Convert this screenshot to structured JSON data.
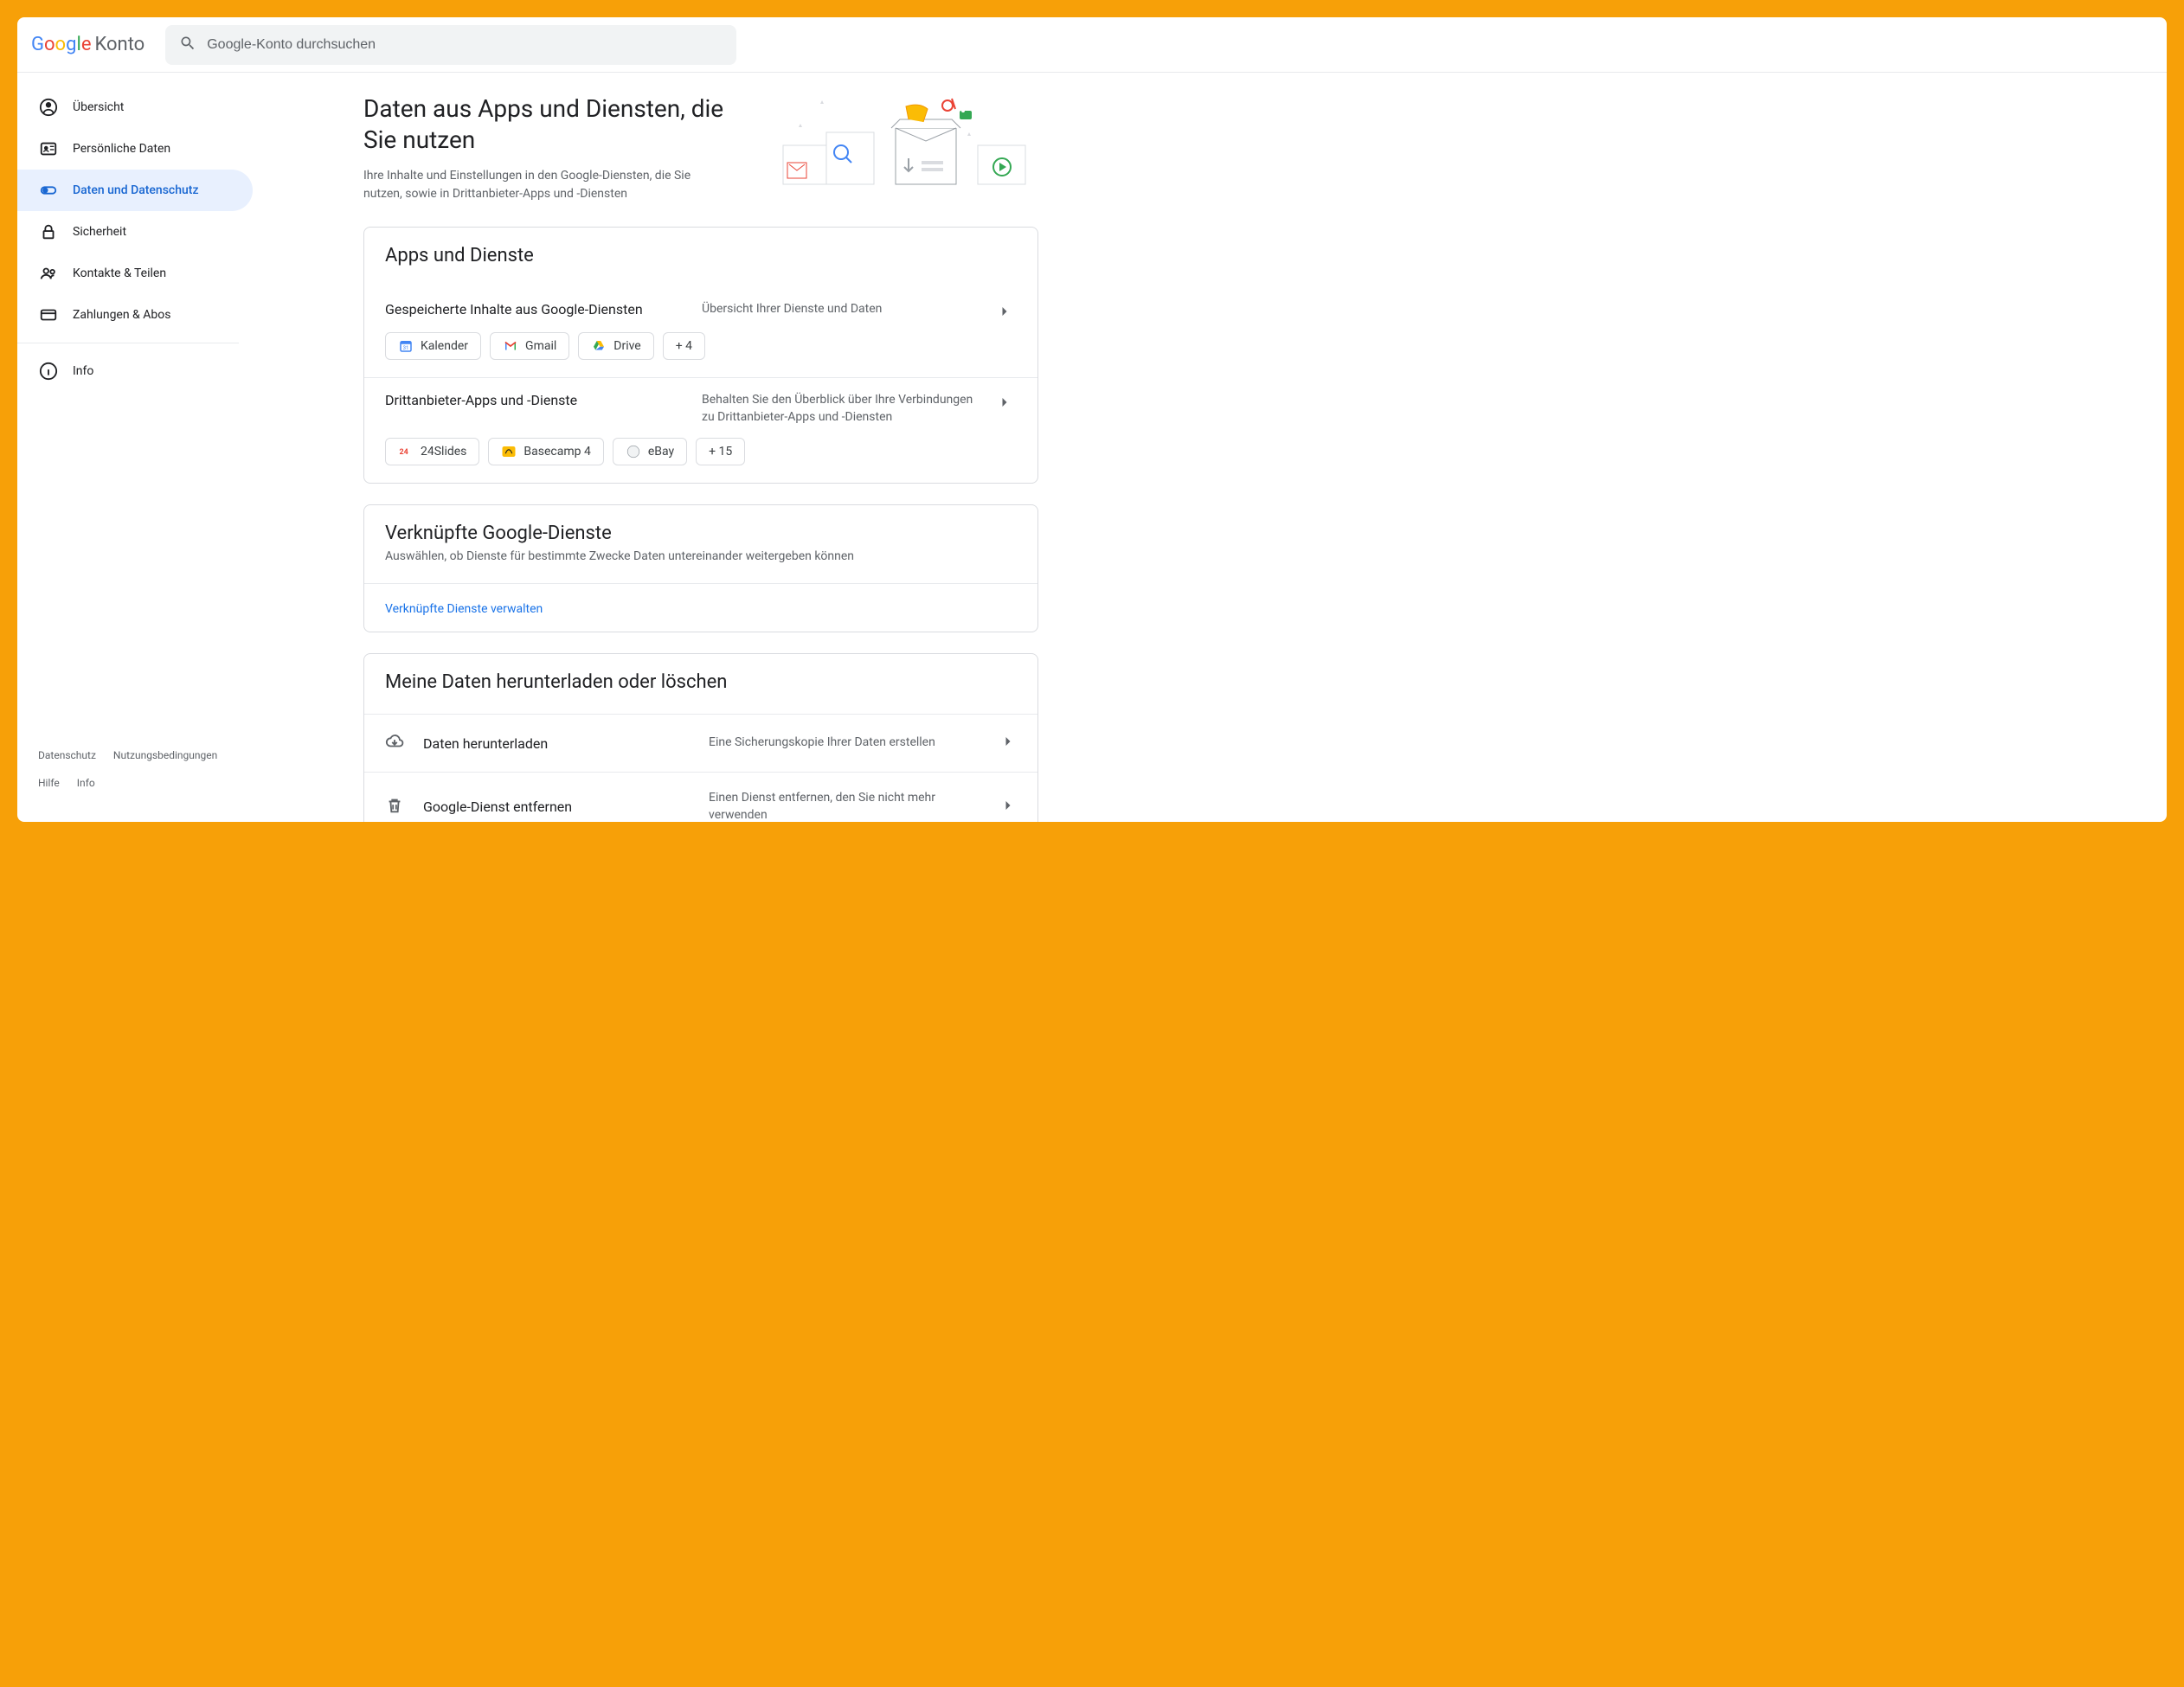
{
  "header": {
    "logo_product": "Konto",
    "search_placeholder": "Google-Konto durchsuchen"
  },
  "sidebar": {
    "items": [
      {
        "label": "Übersicht"
      },
      {
        "label": "Persönliche Daten"
      },
      {
        "label": "Daten und Datenschutz"
      },
      {
        "label": "Sicherheit"
      },
      {
        "label": "Kontakte & Teilen"
      },
      {
        "label": "Zahlungen & Abos"
      },
      {
        "label": "Info"
      }
    ]
  },
  "hero": {
    "title": "Daten aus Apps und Diensten, die Sie nutzen",
    "subtitle": "Ihre Inhalte und Einstellungen in den Google-Diensten, die Sie nutzen, sowie in Drittanbieter-Apps und -Diensten"
  },
  "card_apps": {
    "title": "Apps und Dienste",
    "google_section_title": "Gespeicherte Inhalte aus Google-Diensten",
    "google_section_desc": "Übersicht Ihrer Dienste und Daten",
    "google_chips": [
      {
        "label": "Kalender"
      },
      {
        "label": "Gmail"
      },
      {
        "label": "Drive"
      }
    ],
    "google_more": "+ 4",
    "third_section_title": "Drittanbieter-Apps und -Dienste",
    "third_section_desc": "Behalten Sie den Überblick über Ihre Verbindungen zu Drittanbieter-Apps und -Diensten",
    "third_chips": [
      {
        "label": "24Slides"
      },
      {
        "label": "Basecamp 4"
      },
      {
        "label": "eBay"
      }
    ],
    "third_more": "+ 15"
  },
  "card_linked": {
    "title": "Verknüpfte Google-Dienste",
    "subtitle": "Auswählen, ob Dienste für bestimmte Zwecke Daten untereinander weitergeben können",
    "link": "Verknüpfte Dienste verwalten"
  },
  "card_download": {
    "title": "Meine Daten herunterladen oder löschen",
    "rows": [
      {
        "title": "Daten herunterladen",
        "desc": "Eine Sicherungskopie Ihrer Daten erstellen"
      },
      {
        "title": "Google-Dienst entfernen",
        "desc": "Einen Dienst entfernen, den Sie nicht mehr verwenden"
      }
    ]
  },
  "footer": {
    "privacy": "Datenschutz",
    "terms": "Nutzungsbedingungen",
    "help": "Hilfe",
    "info": "Info"
  }
}
